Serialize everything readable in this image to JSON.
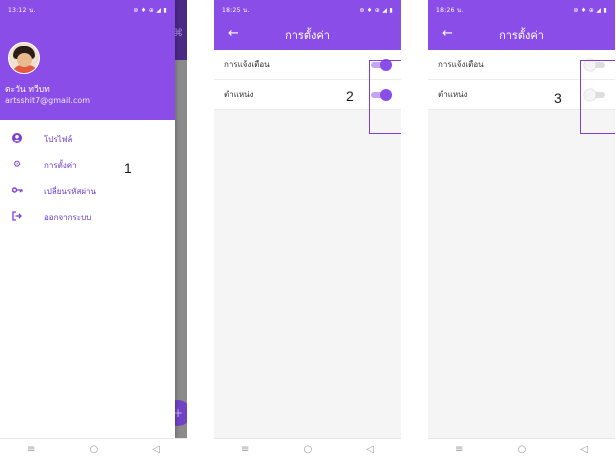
{
  "screen1": {
    "status_time": "13:12 น.",
    "status_icons": "⊛ ♦ ⊕ ◢ ▮",
    "user_name": "ตะวัน ทวีบท",
    "user_email": "artsshit7@gmail.com",
    "menu": [
      {
        "label": "โปรไฟล์",
        "icon": "person-icon"
      },
      {
        "label": "การตั้งค่า",
        "icon": "gear-icon"
      },
      {
        "label": "เปลี่ยนรหัสผ่าน",
        "icon": "key-icon"
      },
      {
        "label": "ออกจากระบบ",
        "icon": "logout-icon"
      }
    ],
    "callout": "1"
  },
  "screen2": {
    "status_time": "18:25 น.",
    "status_icons": "⊛ ♦ ⊕ ◢ ▮",
    "title": "การตั้งค่า",
    "settings": [
      {
        "label": "การแจ้งเตือน",
        "enabled": true
      },
      {
        "label": "ตำแหน่ง",
        "enabled": true
      }
    ],
    "callout": "2"
  },
  "screen3": {
    "status_time": "18:26 น.",
    "status_icons": "⊛ ♦ ⊕ ◢ ▮",
    "title": "การตั้งค่า",
    "settings": [
      {
        "label": "การแจ้งเตือน",
        "enabled": false
      },
      {
        "label": "ตำแหน่ง",
        "enabled": false
      }
    ],
    "callout": "3"
  },
  "navbar": {
    "menu": "≡",
    "home": "○",
    "back": "◁"
  },
  "colors": {
    "primary": "#8a4de8",
    "highlight": "#7b3fd8"
  }
}
